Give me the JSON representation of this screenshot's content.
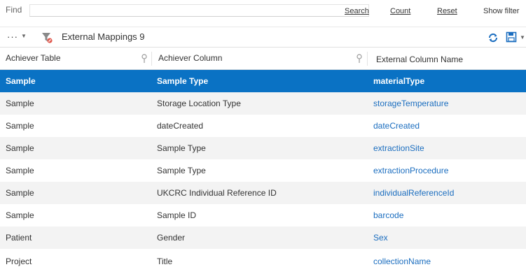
{
  "find": {
    "label": "Find",
    "value": "",
    "placeholder": "",
    "search_label": "Search",
    "count_label": "Count",
    "reset_label": "Reset",
    "show_filter_label": "Show filter"
  },
  "toolbar": {
    "more_label": "···",
    "title": "External Mappings 9"
  },
  "columns": {
    "achiever_table": "Achiever Table",
    "achiever_column": "Achiever Column",
    "external_column_name": "External Column Name"
  },
  "rows": [
    {
      "table": "Sample",
      "column": "Sample Type",
      "external": "materialType"
    },
    {
      "table": "Sample",
      "column": "Storage Location Type",
      "external": "storageTemperature"
    },
    {
      "table": "Sample",
      "column": "dateCreated",
      "external": "dateCreated"
    },
    {
      "table": "Sample",
      "column": "Sample Type",
      "external": "extractionSite"
    },
    {
      "table": "Sample",
      "column": "Sample Type",
      "external": "extractionProcedure"
    },
    {
      "table": "Sample",
      "column": "UKCRC Individual Reference ID",
      "external": "individualReferenceId"
    },
    {
      "table": "Sample",
      "column": "Sample ID",
      "external": "barcode"
    },
    {
      "table": "Patient",
      "column": "Gender",
      "external": "Sex"
    },
    {
      "table": "Project",
      "column": "Title",
      "external": "collectionName"
    }
  ],
  "colors": {
    "selected_row": "#0a72c4",
    "link": "#1a6dbf",
    "alt_row": "#f3f3f3",
    "refresh_icon": "#1a6dbf",
    "save_icon": "#1a6dbf",
    "filter_icon_badge": "#e05a4f"
  },
  "icons": {
    "filter": "filter-clear-icon",
    "refresh": "refresh-icon",
    "save": "save-icon",
    "pin": "pin-icon"
  }
}
